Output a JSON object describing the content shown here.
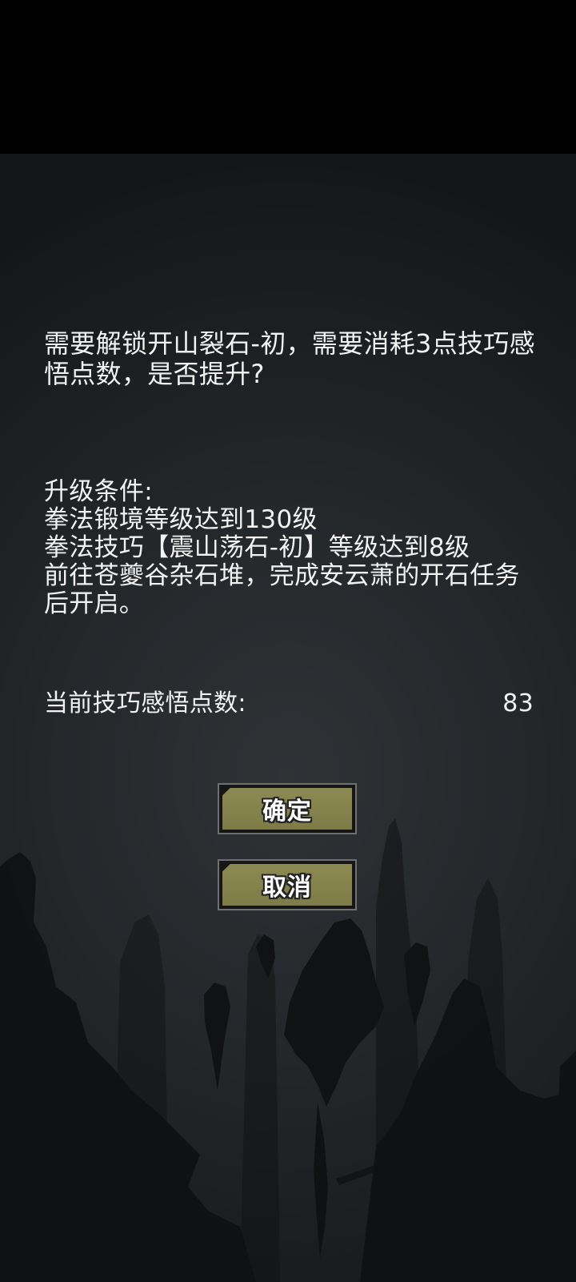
{
  "dialog": {
    "question": "需要解锁开山裂石-初，需要消耗3点技巧感悟点数，是否提升?",
    "conditions_title": "升级条件:",
    "conditions": [
      "拳法锻境等级达到130级",
      "拳法技巧【震山荡石-初】等级达到8级",
      "前往苍夔谷杂石堆，完成安云萧的开石任务后开启。"
    ],
    "points_label": "当前技巧感悟点数:",
    "points_value": "83",
    "confirm_label": "确定",
    "cancel_label": "取消"
  },
  "colors": {
    "text": "#f2f2f2",
    "button_fill": "#8b8a52",
    "button_border": "#6f6f6f",
    "background": "#24272a"
  }
}
